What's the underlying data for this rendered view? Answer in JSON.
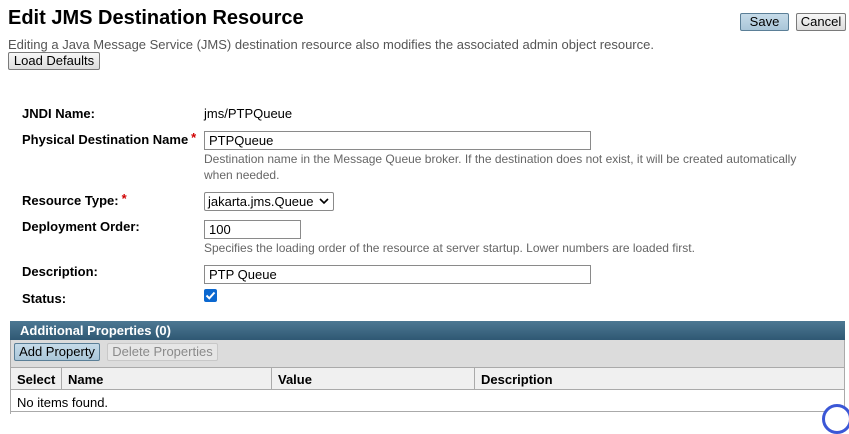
{
  "header": {
    "title": "Edit JMS Destination Resource",
    "description": "Editing a Java Message Service (JMS) destination resource also modifies the associated admin object resource.",
    "load_defaults": "Load Defaults",
    "save": "Save",
    "cancel": "Cancel"
  },
  "form": {
    "jndi_label": "JNDI Name:",
    "jndi_value": "jms/PTPQueue",
    "physical_label": "Physical Destination Name",
    "physical_value": "PTPQueue",
    "physical_help": "Destination name in the Message Queue broker. If the destination does not exist, it will be created automatically when needed.",
    "resource_type_label": "Resource Type:",
    "resource_type_value": "jakarta.jms.Queue",
    "deploy_order_label": "Deployment Order:",
    "deploy_order_value": "100",
    "deploy_order_help": "Specifies the loading order of the resource at server startup. Lower numbers are loaded first.",
    "description_label": "Description:",
    "description_value": "PTP Queue",
    "status_label": "Status:",
    "status_checked": true,
    "required_marker": "*"
  },
  "properties": {
    "title": "Additional Properties (0)",
    "add": "Add Property",
    "delete": "Delete Properties",
    "columns": [
      "Select",
      "Name",
      "Value",
      "Description"
    ],
    "empty_text": "No items found."
  },
  "colors": {
    "required": "#d00000",
    "panel_header": "#2f5873",
    "checkbox": "#0b68d0"
  }
}
